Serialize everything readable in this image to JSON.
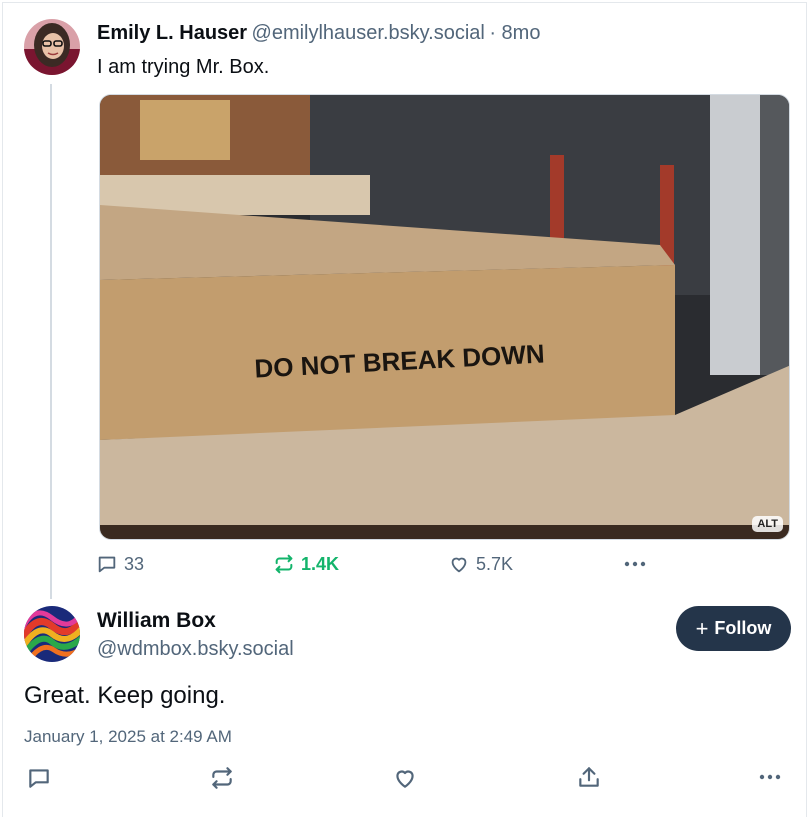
{
  "colors": {
    "accent": "#1083fe",
    "repost_active": "#13b46b",
    "muted": "#52667a",
    "follow_bg": "#24354a",
    "thread_line": "#d4dbe2"
  },
  "parent_post": {
    "author_name": "Emily L. Hauser",
    "author_handle": "@emilylhauser.bsky.social",
    "timestamp": "· 8mo",
    "text": "I am trying Mr. Box.",
    "image": {
      "box_text": "DO NOT BREAK DOWN",
      "alt_badge": "ALT"
    },
    "stats": {
      "replies": "33",
      "reposts": "1.4K",
      "likes": "5.7K"
    },
    "icons": [
      "reply-icon",
      "repost-icon",
      "like-icon",
      "more-icon"
    ]
  },
  "main_post": {
    "author_name": "William Box",
    "author_handle": "@wdmbox.bsky.social",
    "follow_label": "Follow",
    "follow_icon": "+",
    "text": "Great. Keep going.",
    "timestamp": "January 1, 2025 at 2:49 AM",
    "icons": [
      "reply-icon",
      "repost-icon",
      "like-icon",
      "share-icon",
      "more-icon"
    ]
  }
}
